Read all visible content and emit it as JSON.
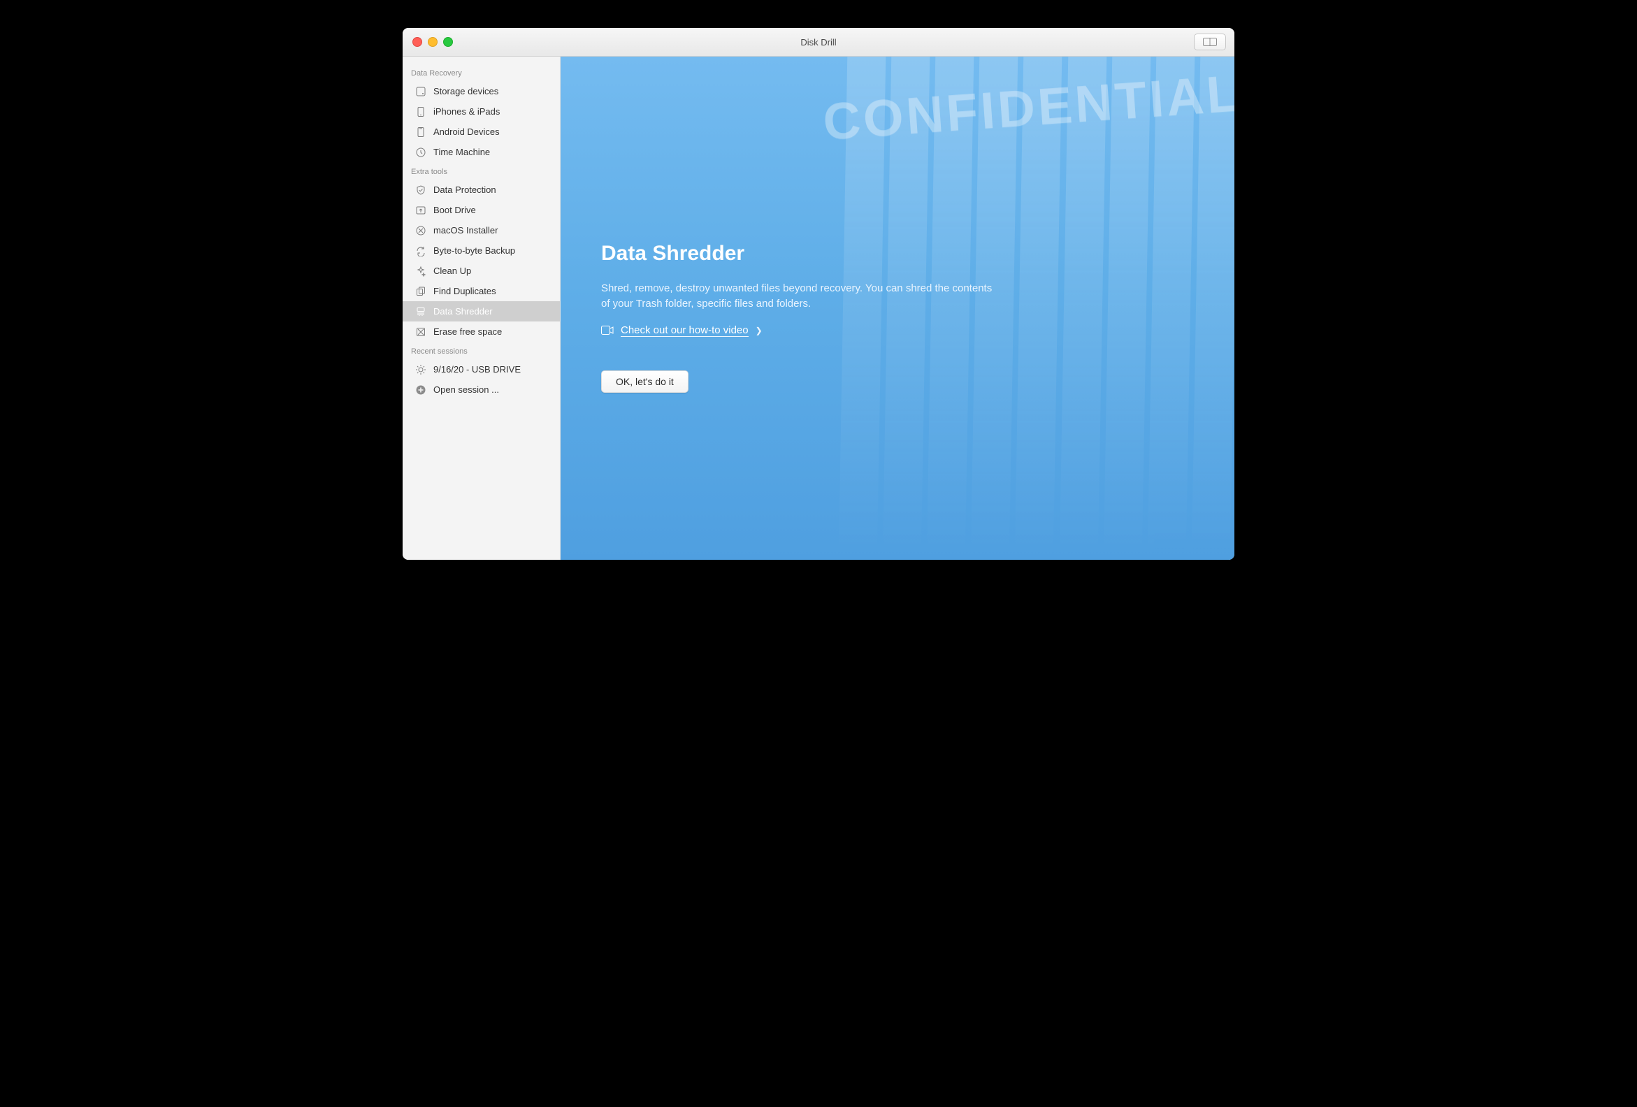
{
  "window": {
    "title": "Disk Drill"
  },
  "sidebar": {
    "sections": [
      {
        "title": "Data Recovery",
        "items": [
          {
            "label": "Storage devices",
            "icon": "hdd-icon"
          },
          {
            "label": "iPhones & iPads",
            "icon": "phone-icon"
          },
          {
            "label": "Android Devices",
            "icon": "phone-icon"
          },
          {
            "label": "Time Machine",
            "icon": "clock-icon"
          }
        ]
      },
      {
        "title": "Extra tools",
        "items": [
          {
            "label": "Data Protection",
            "icon": "shield-icon"
          },
          {
            "label": "Boot Drive",
            "icon": "boot-icon"
          },
          {
            "label": "macOS Installer",
            "icon": "disc-icon"
          },
          {
            "label": "Byte-to-byte Backup",
            "icon": "refresh-icon"
          },
          {
            "label": "Clean Up",
            "icon": "sparkle-icon"
          },
          {
            "label": "Find Duplicates",
            "icon": "duplicates-icon"
          },
          {
            "label": "Data Shredder",
            "icon": "shredder-icon",
            "active": true
          },
          {
            "label": "Erase free space",
            "icon": "erase-icon"
          }
        ]
      },
      {
        "title": "Recent sessions",
        "items": [
          {
            "label": "9/16/20 - USB DRIVE",
            "icon": "gear-icon"
          },
          {
            "label": "Open session ...",
            "icon": "plus-icon"
          }
        ]
      }
    ]
  },
  "main": {
    "watermark": "CONFIDENTIAL",
    "heading": "Data Shredder",
    "description": "Shred, remove, destroy unwanted files beyond recovery. You can shred the contents of your Trash folder, specific files and folders.",
    "video_link": "Check out our how-to video",
    "cta": "OK, let's do it"
  },
  "colors": {
    "accent": "#5faee8",
    "sidebar_bg": "#f4f4f4",
    "sidebar_selected": "#cfcfcf"
  }
}
